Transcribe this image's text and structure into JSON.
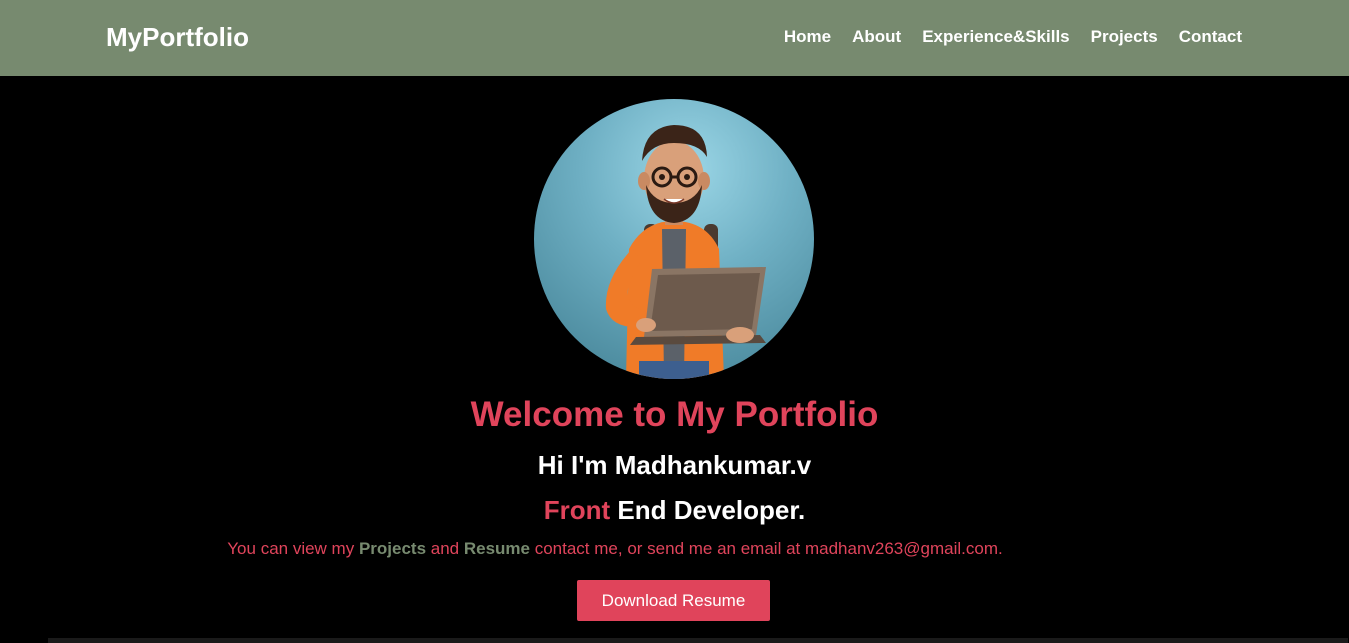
{
  "navbar": {
    "brand": "MyPortfolio",
    "links": [
      {
        "label": "Home"
      },
      {
        "label": "About"
      },
      {
        "label": "Experience&Skills"
      },
      {
        "label": "Projects"
      },
      {
        "label": "Contact"
      }
    ]
  },
  "hero": {
    "welcome": "Welcome to My Portfolio",
    "greeting": "Hi I'm Madhankumar.v",
    "role_accent": "Front",
    "role_rest": " End Developer.",
    "intro": {
      "part1": "You can view my ",
      "projects_link": "Projects",
      "part2": " and ",
      "resume_link": "Resume",
      "part3": " contact me, or send me an email at madhanv263@gmail.com."
    },
    "download_button": "Download Resume"
  },
  "colors": {
    "navbar_bg": "#778a6f",
    "accent": "#e0445b",
    "background": "#000000",
    "link_green": "#778a6f"
  }
}
